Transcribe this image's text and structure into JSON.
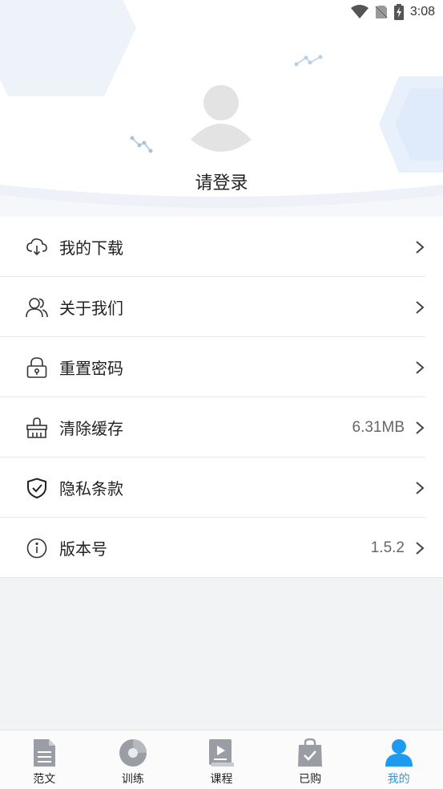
{
  "status_bar": {
    "time": "3:08",
    "icons": [
      "wifi-icon",
      "no-sim-icon",
      "battery-charging-icon"
    ]
  },
  "profile": {
    "avatar_icon": "user-avatar-placeholder",
    "login_label": "请登录"
  },
  "menu": {
    "items": [
      {
        "label": "我的下载",
        "icon": "cloud-download-icon",
        "value": ""
      },
      {
        "label": "关于我们",
        "icon": "users-icon",
        "value": ""
      },
      {
        "label": "重置密码",
        "icon": "lock-icon",
        "value": ""
      },
      {
        "label": "清除缓存",
        "icon": "broom-icon",
        "value": "6.31MB"
      },
      {
        "label": "隐私条款",
        "icon": "shield-check-icon",
        "value": ""
      },
      {
        "label": "版本号",
        "icon": "info-icon",
        "value": "1.5.2"
      }
    ]
  },
  "tabbar": {
    "tabs": [
      {
        "label": "范文",
        "icon": "document-icon",
        "active": false
      },
      {
        "label": "训练",
        "icon": "disc-icon",
        "active": false
      },
      {
        "label": "课程",
        "icon": "video-book-icon",
        "active": false
      },
      {
        "label": "已购",
        "icon": "shopping-bag-check-icon",
        "active": false
      },
      {
        "label": "我的",
        "icon": "user-icon",
        "active": true
      }
    ]
  },
  "colors": {
    "accent": "#1e9bf0",
    "icon_gray": "#999da3",
    "background": "#f2f3f5"
  }
}
